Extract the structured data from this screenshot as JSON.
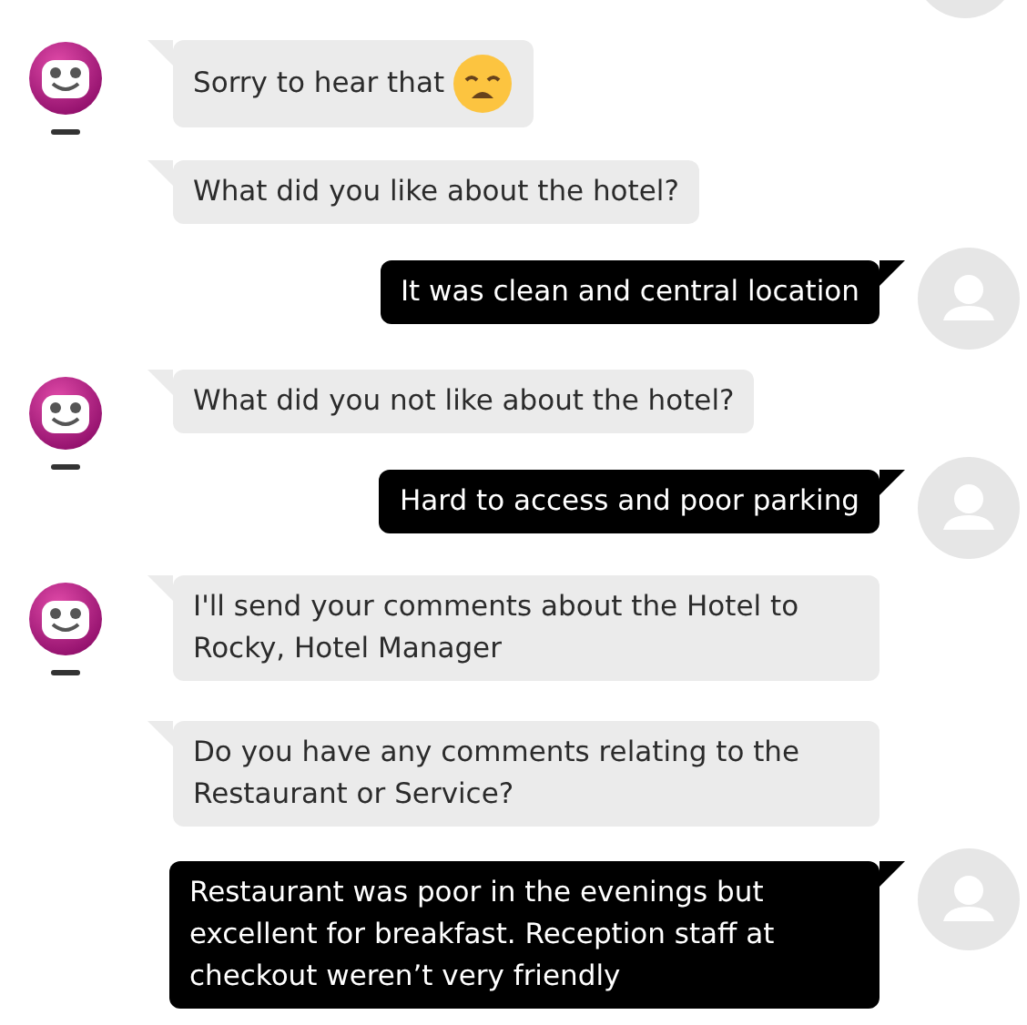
{
  "messages": [
    {
      "kind": "avatar-only"
    },
    {
      "kind": "bot",
      "show_avatar": true,
      "text": "Sorry to hear that",
      "sad_emoji": true
    },
    {
      "kind": "bot",
      "show_avatar": false,
      "text": "What did you like about the hotel?"
    },
    {
      "kind": "user",
      "text": "It was clean and central location"
    },
    {
      "kind": "bot",
      "show_avatar": true,
      "text": "What did you not like about the hotel?"
    },
    {
      "kind": "user",
      "text": "Hard to access and poor parking"
    },
    {
      "kind": "bot",
      "show_avatar": true,
      "text": "I'll send your comments about the Hotel to Rocky, Hotel Manager"
    },
    {
      "kind": "bot",
      "show_avatar": false,
      "text": "Do you have any comments relating to the Restaurant or Service?"
    },
    {
      "kind": "user",
      "text": "Restaurant was poor in the evenings but excellent for breakfast. Reception staff at checkout weren’t very friendly"
    }
  ]
}
